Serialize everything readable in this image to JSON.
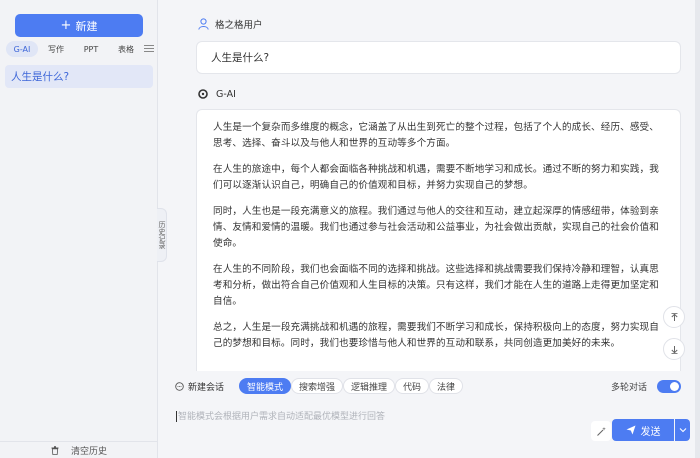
{
  "sidebar": {
    "new_label": "新建",
    "tabs": [
      {
        "label": "G-AI",
        "active": true
      },
      {
        "label": "写作",
        "active": false
      },
      {
        "label": "PPT",
        "active": false
      },
      {
        "label": "表格",
        "active": false
      }
    ],
    "history": [
      {
        "label": "人生是什么?",
        "active": true
      }
    ],
    "clear_label": "清空历史"
  },
  "collapse_handle": {
    "label": "历史记录"
  },
  "chat": {
    "user_name": "格之格用户",
    "question": "人生是什么?",
    "ai_name": "G-AI",
    "answer": [
      "人生是一个复杂而多维度的概念，它涵盖了从出生到死亡的整个过程，包括了个人的成长、经历、感受、思考、选择、奋斗以及与他人和世界的互动等多个方面。",
      "在人生的旅途中，每个人都会面临各种挑战和机遇，需要不断地学习和成长。通过不断的努力和实践，我们可以逐渐认识自己，明确自己的价值观和目标，并努力实现自己的梦想。",
      "同时，人生也是一段充满意义的旅程。我们通过与他人的交往和互动，建立起深厚的情感纽带，体验到亲情、友情和爱情的温暖。我们也通过参与社会活动和公益事业，为社会做出贡献，实现自己的社会价值和使命。",
      "在人生的不同阶段，我们也会面临不同的选择和挑战。这些选择和挑战需要我们保持冷静和理智，认真思考和分析，做出符合自己价值观和人生目标的决策。只有这样，我们才能在人生的道路上走得更加坚定和自信。",
      "总之，人生是一段充满挑战和机遇的旅程，需要我们不断学习和成长，保持积极向上的态度，努力实现自己的梦想和目标。同时，我们也要珍惜与他人和世界的互动和联系，共同创造更加美好的未来。"
    ]
  },
  "toolbar": {
    "new_chat": "新建会话",
    "modes": [
      {
        "label": "智能模式",
        "active": true
      },
      {
        "label": "搜索增强",
        "active": false
      },
      {
        "label": "逻辑推理",
        "active": false
      },
      {
        "label": "代码",
        "active": false
      },
      {
        "label": "法律",
        "active": false
      }
    ],
    "multi_turn_label": "多轮对话",
    "multi_turn_on": true
  },
  "input": {
    "placeholder": "智能模式会根据用户需求自动适配最优模型进行回答",
    "send_label": "发送"
  },
  "colors": {
    "accent": "#4d7cf2"
  }
}
